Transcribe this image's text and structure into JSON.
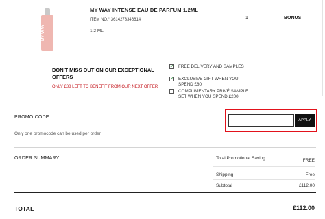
{
  "product": {
    "image_label": "MY WAY",
    "name": "MY WAY INTENSE EAU DE PARFUM 1.2ML",
    "item_no": "ITEM NO.° 3614273346614",
    "size": "1.2 ML",
    "quantity": "1",
    "price": "BONUS"
  },
  "offers": {
    "title": "DON'T MISS OUT ON OUR EXCEPTIONAL OFFERS",
    "subtitle": "ONLY £88 LEFT TO BENEFIT FROM OUR NEXT OFFER",
    "benefits": [
      {
        "label": "FREE DELIVERY AND SAMPLES",
        "checked": true,
        "mark": "✓"
      },
      {
        "label": "EXCLUSIVE GIFT WHEN YOU SPEND £80",
        "checked": true,
        "mark": "✓"
      },
      {
        "label": "COMPLIMENTARY PRIVÉ SAMPLE SET WHEN YOU SPEND £200",
        "checked": false,
        "mark": ""
      }
    ]
  },
  "promo": {
    "label": "PROMO CODE",
    "input_value": "",
    "apply_label": "APPLY",
    "note": "Only one promocode can be used per order"
  },
  "summary": {
    "title": "ORDER SUMMARY",
    "rows": [
      {
        "label": "Total Promotional Saving",
        "value": "FREE"
      },
      {
        "label": "Shipping",
        "value": "Free"
      },
      {
        "label": "Subtotal",
        "value": "£112.00"
      }
    ],
    "total_label": "TOTAL",
    "total_value": "£112.00"
  },
  "colors": {
    "accent_red": "#c4161c",
    "highlight_border": "#e2121b",
    "apply_button": "#111111"
  }
}
